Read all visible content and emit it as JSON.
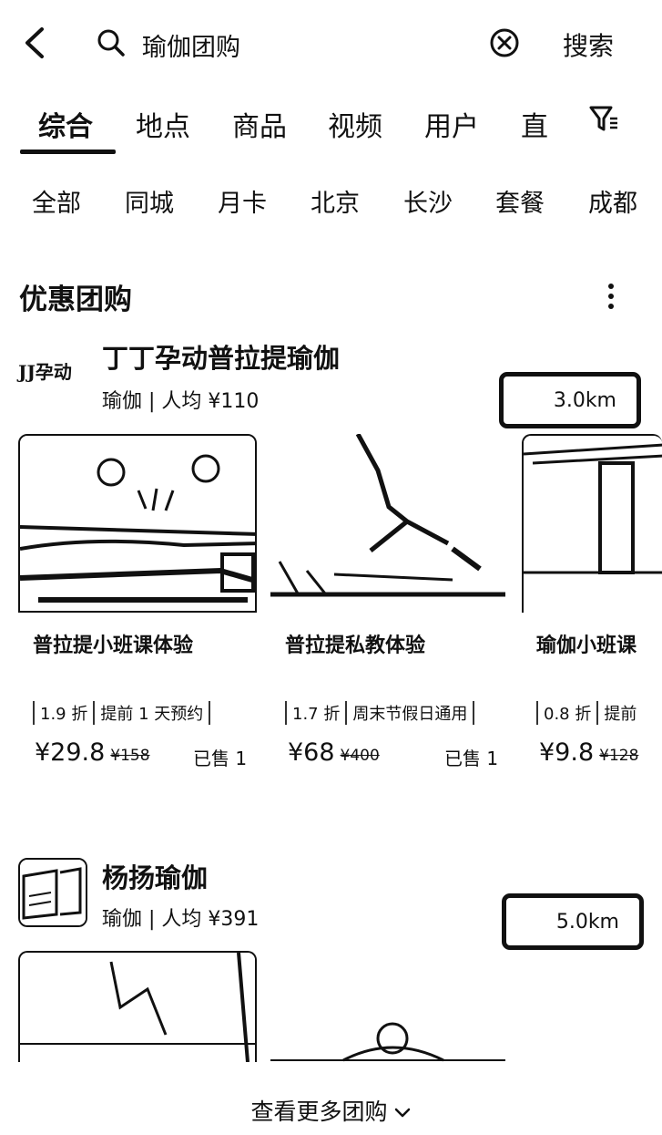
{
  "header": {
    "back_icon": "chevron-left-icon",
    "search_icon": "search-icon",
    "query": "瑜伽团购",
    "clear_icon": "close-circle-icon",
    "search_button": "搜索"
  },
  "tabs": [
    "综合",
    "地点",
    "商品",
    "视频",
    "用户",
    "直"
  ],
  "active_tab": "综合",
  "filter_icon": "filter-icon",
  "tags": [
    "全部",
    "同城",
    "月卡",
    "北京",
    "长沙",
    "套餐",
    "成都"
  ],
  "section": {
    "title": "优惠团购",
    "more_icon": "more-vertical-icon"
  },
  "shops": [
    {
      "logo_text": "JJ孕动",
      "name": "丁丁孕动普拉提瑜伽",
      "meta": "瑜伽 | 人均 ¥110",
      "distance": "3.0km",
      "deals": [
        {
          "title": "普拉提小班课体验",
          "tags": [
            "1.9 折",
            "提前 1 天预约"
          ],
          "price": "¥29.8",
          "original": "¥158",
          "sold": "已售 1"
        },
        {
          "title": "普拉提私教体验",
          "tags": [
            "1.7 折",
            "周末节假日通用"
          ],
          "price": "¥68",
          "original": "¥400",
          "sold": "已售 1"
        },
        {
          "title": "瑜伽小班课",
          "tags": [
            "0.8 折",
            "提前"
          ],
          "price": "¥9.8",
          "original": "¥128",
          "sold": ""
        }
      ]
    },
    {
      "name": "杨扬瑜伽",
      "meta": "瑜伽 | 人均 ¥391",
      "distance": "5.0km"
    }
  ],
  "see_more": "查看更多团购"
}
